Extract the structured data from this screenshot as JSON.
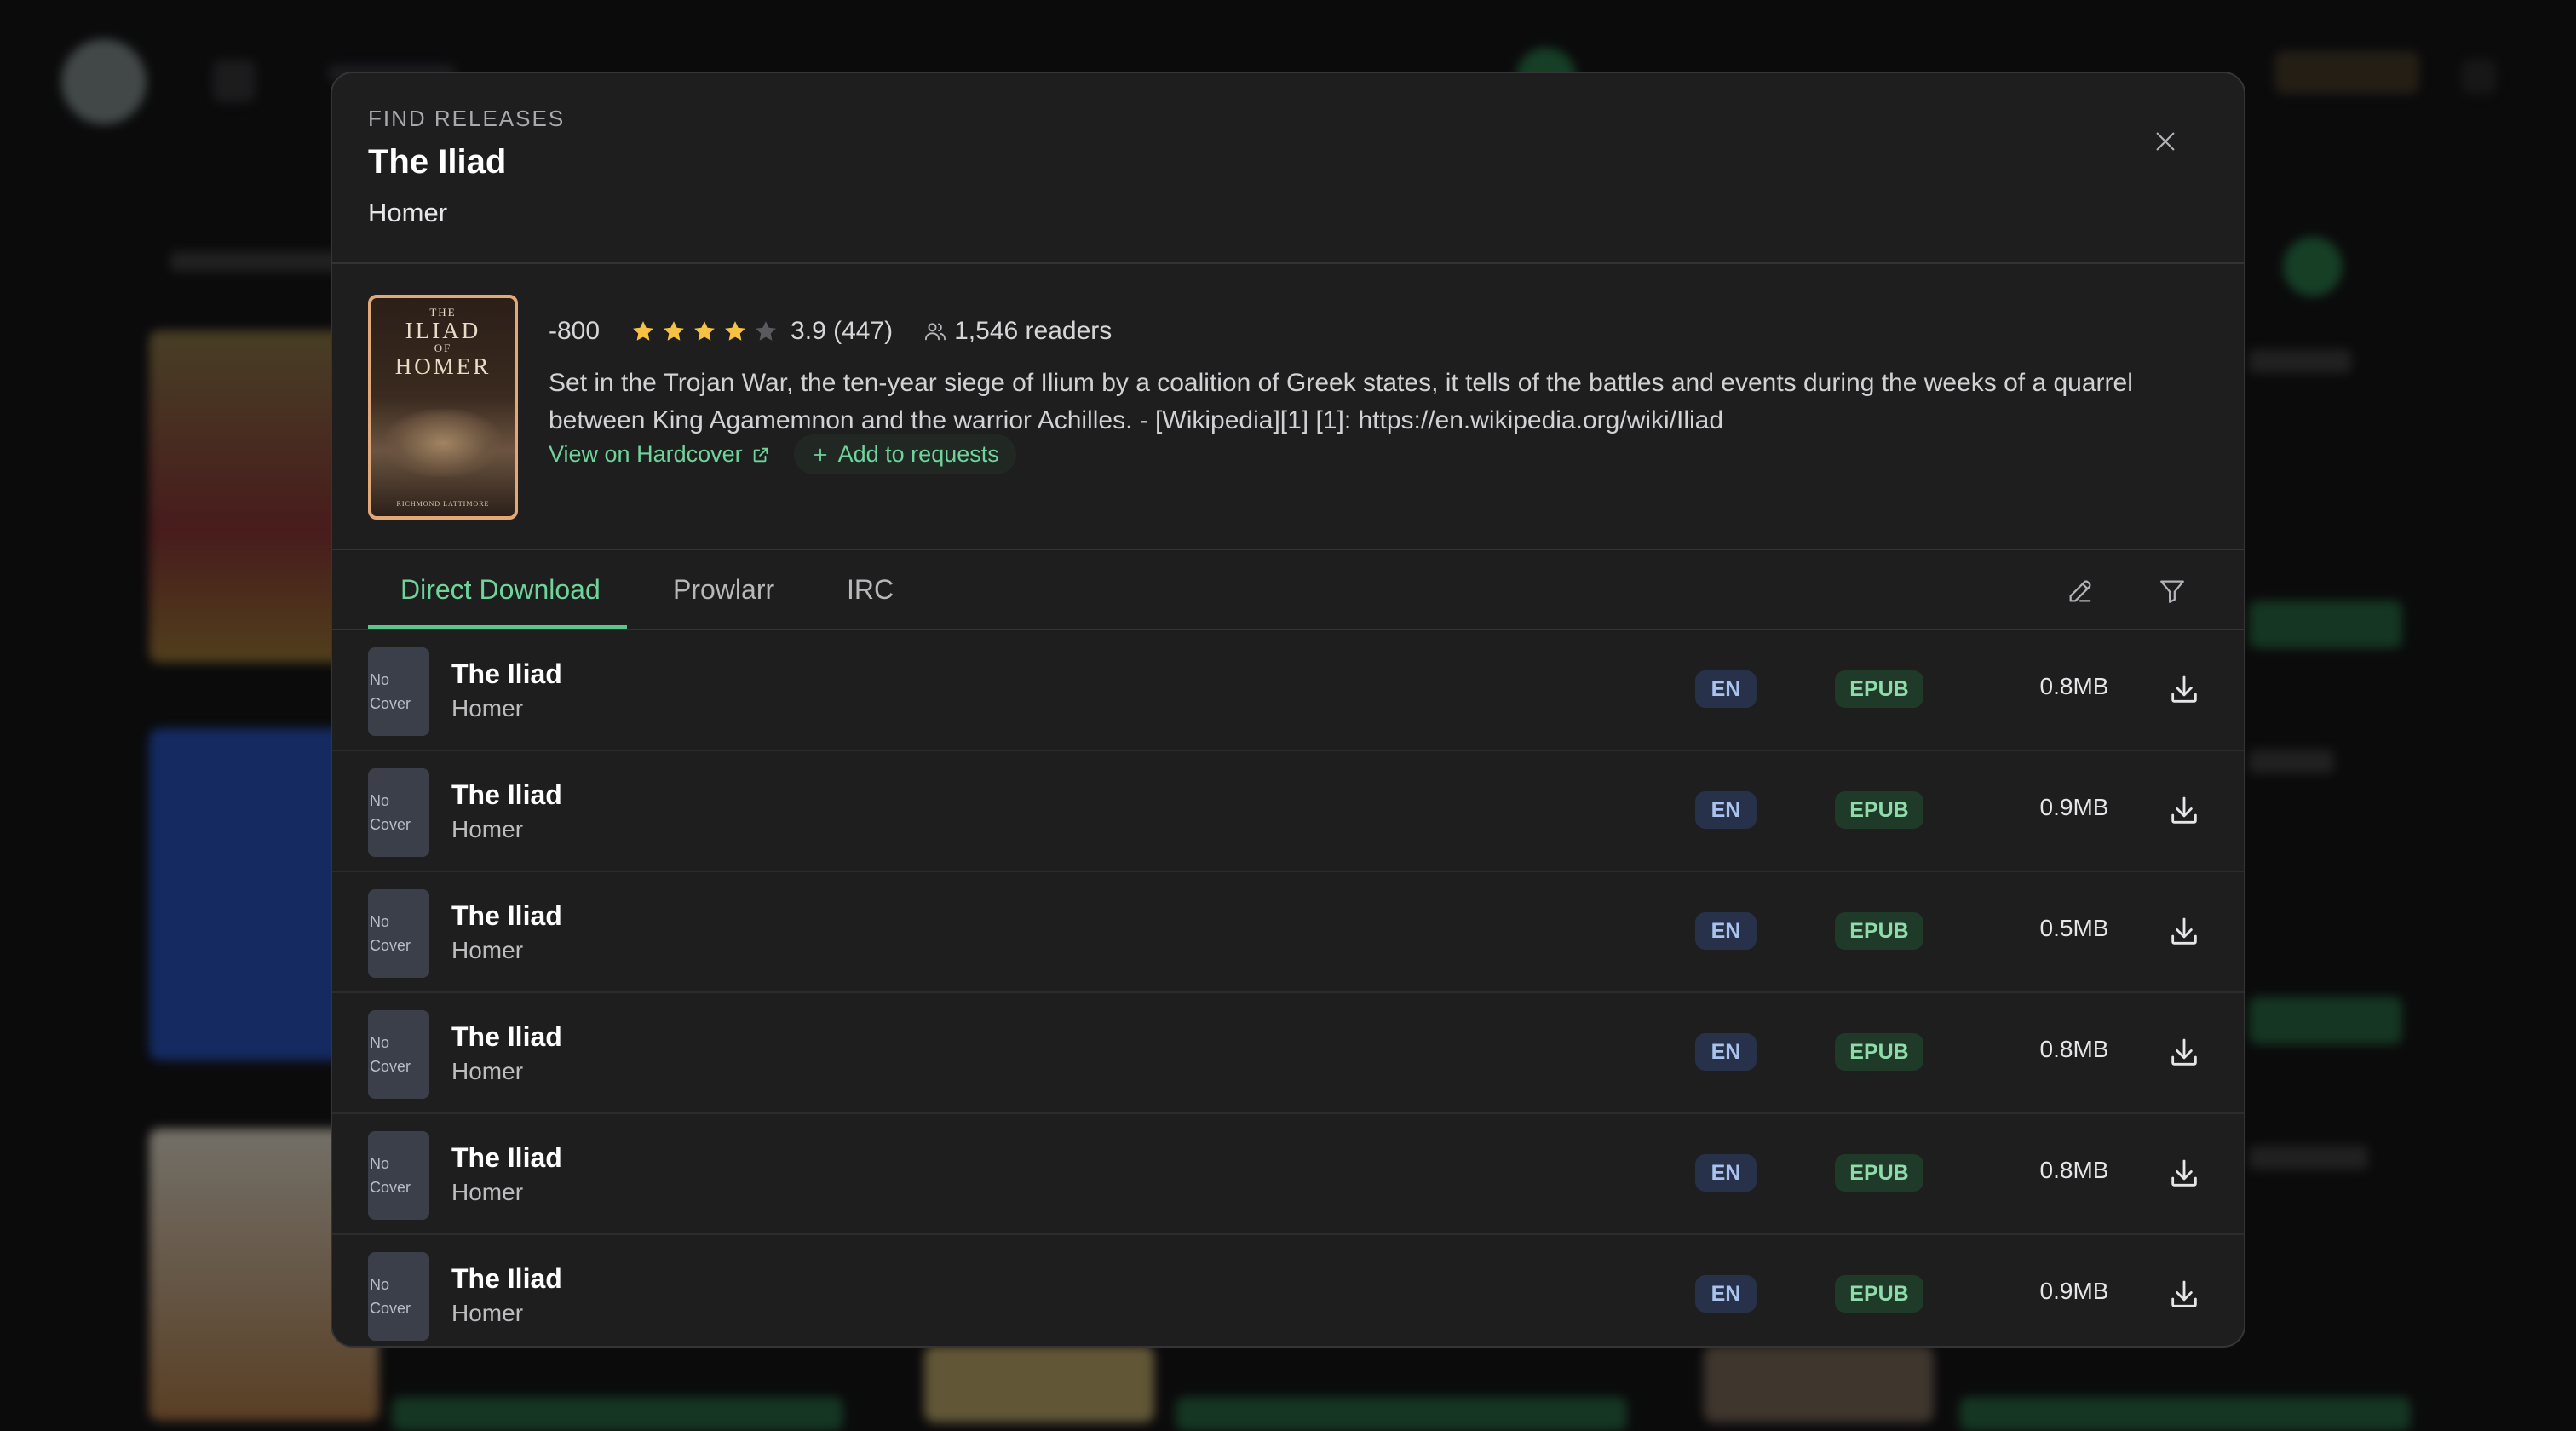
{
  "modal": {
    "eyebrow": "FIND RELEASES",
    "title": "The Iliad",
    "author": "Homer",
    "close_icon": "close-icon"
  },
  "book": {
    "cover": {
      "small_top": "THE",
      "title": "ILIAD",
      "small_mid": "OF",
      "name": "HOMER",
      "translator": "RICHMOND LATTIMORE"
    },
    "year": "-800",
    "rating_stars": 4,
    "rating_max": 5,
    "rating_text": "3.9 (447)",
    "readers": "1,546 readers",
    "description": "Set in the Trojan War, the ten-year siege of Ilium by a coalition of Greek states, it tells of the battles and events during the weeks of a quarrel between King Agamemnon and the warrior Achilles. - [Wikipedia][1] [1]: https://en.wikipedia.org/wiki/Iliad",
    "hardcover_link": "View on Hardcover",
    "add_requests": "Add to requests"
  },
  "tabs": [
    {
      "label": "Direct Download",
      "active": true
    },
    {
      "label": "Prowlarr",
      "active": false
    },
    {
      "label": "IRC",
      "active": false
    }
  ],
  "tools": [
    "edit-icon",
    "filter-icon"
  ],
  "results": [
    {
      "cover": "No Cover",
      "title": "The Iliad",
      "author": "Homer",
      "lang": "EN",
      "format": "EPUB",
      "size": "0.8MB"
    },
    {
      "cover": "No Cover",
      "title": "The Iliad",
      "author": "Homer",
      "lang": "EN",
      "format": "EPUB",
      "size": "0.9MB"
    },
    {
      "cover": "No Cover",
      "title": "The Iliad",
      "author": "Homer",
      "lang": "EN",
      "format": "EPUB",
      "size": "0.5MB"
    },
    {
      "cover": "No Cover",
      "title": "The Iliad",
      "author": "Homer",
      "lang": "EN",
      "format": "EPUB",
      "size": "0.8MB"
    },
    {
      "cover": "No Cover",
      "title": "The Iliad",
      "author": "Homer",
      "lang": "EN",
      "format": "EPUB",
      "size": "0.8MB"
    },
    {
      "cover": "No Cover",
      "title": "The Iliad",
      "author": "Homer",
      "lang": "EN",
      "format": "EPUB",
      "size": "0.9MB"
    }
  ],
  "colors": {
    "accent": "#6fd49a",
    "star": "#f5c242",
    "star_empty": "#5a5a5e",
    "lang_badge": "#27324a",
    "format_badge": "#1f3a29"
  }
}
